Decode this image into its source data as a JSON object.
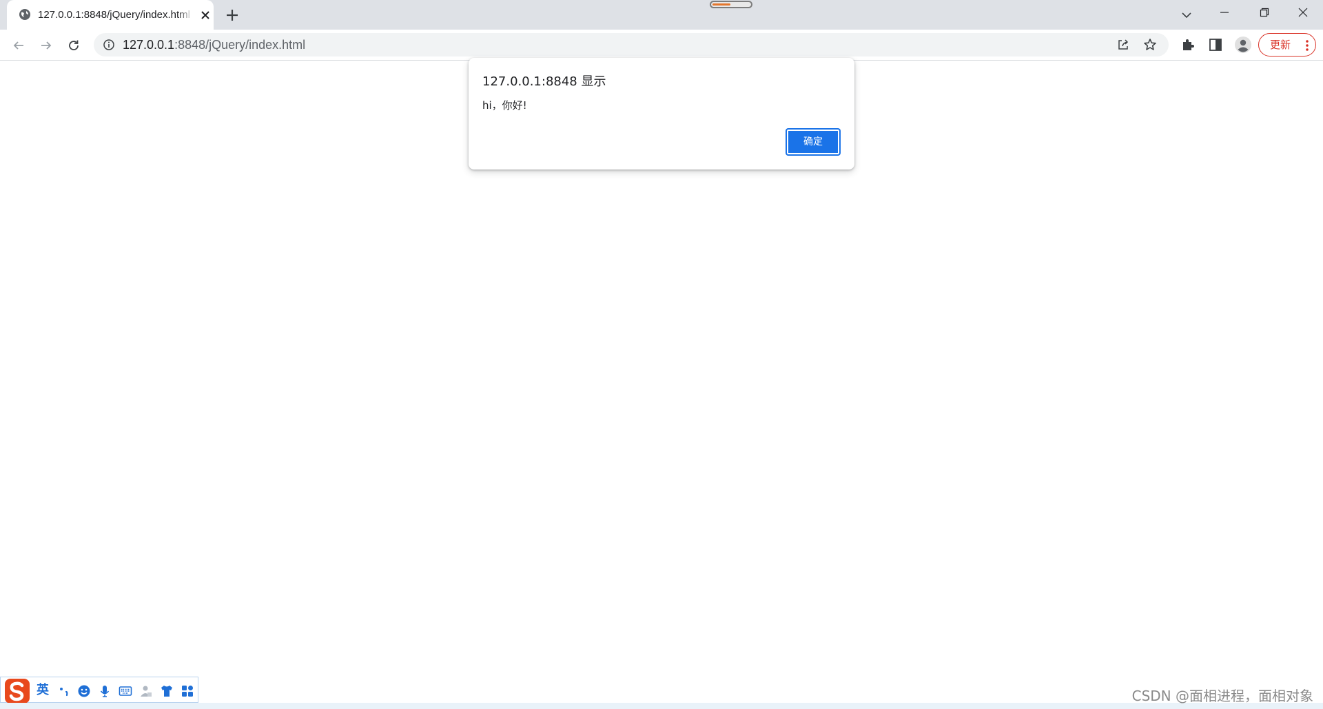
{
  "browser": {
    "tab": {
      "title": "127.0.0.1:8848/jQuery/index.html",
      "favicon": "globe-icon"
    },
    "address_bar": {
      "host": "127.0.0.1",
      "path": ":8848/jQuery/index.html"
    },
    "update_button_label": "更新",
    "icons": {
      "back": "arrow-left-icon",
      "forward": "arrow-right-icon",
      "reload": "reload-icon",
      "site_info": "info-icon",
      "share": "share-icon",
      "bookmark": "star-icon",
      "extensions": "puzzle-icon",
      "side_panel": "side-panel-icon",
      "profile": "person-icon",
      "menu": "kebab-menu-icon"
    }
  },
  "alert_dialog": {
    "title": "127.0.0.1:8848 显示",
    "message": "hi，你好!",
    "ok_label": "确定"
  },
  "ime_toolbar": {
    "mode_label": "英",
    "icons": [
      "punctuation-icon",
      "emoji-icon",
      "microphone-icon",
      "keyboard-icon",
      "user-icon",
      "skin-shirt-icon",
      "toolbox-icon"
    ]
  },
  "watermark": "CSDN @面相进程，面相对象",
  "colors": {
    "accent_blue": "#1a73e8",
    "update_red": "#d93025",
    "tab_strip": "#dee1e6",
    "ime_blue": "#1f6fd6"
  }
}
